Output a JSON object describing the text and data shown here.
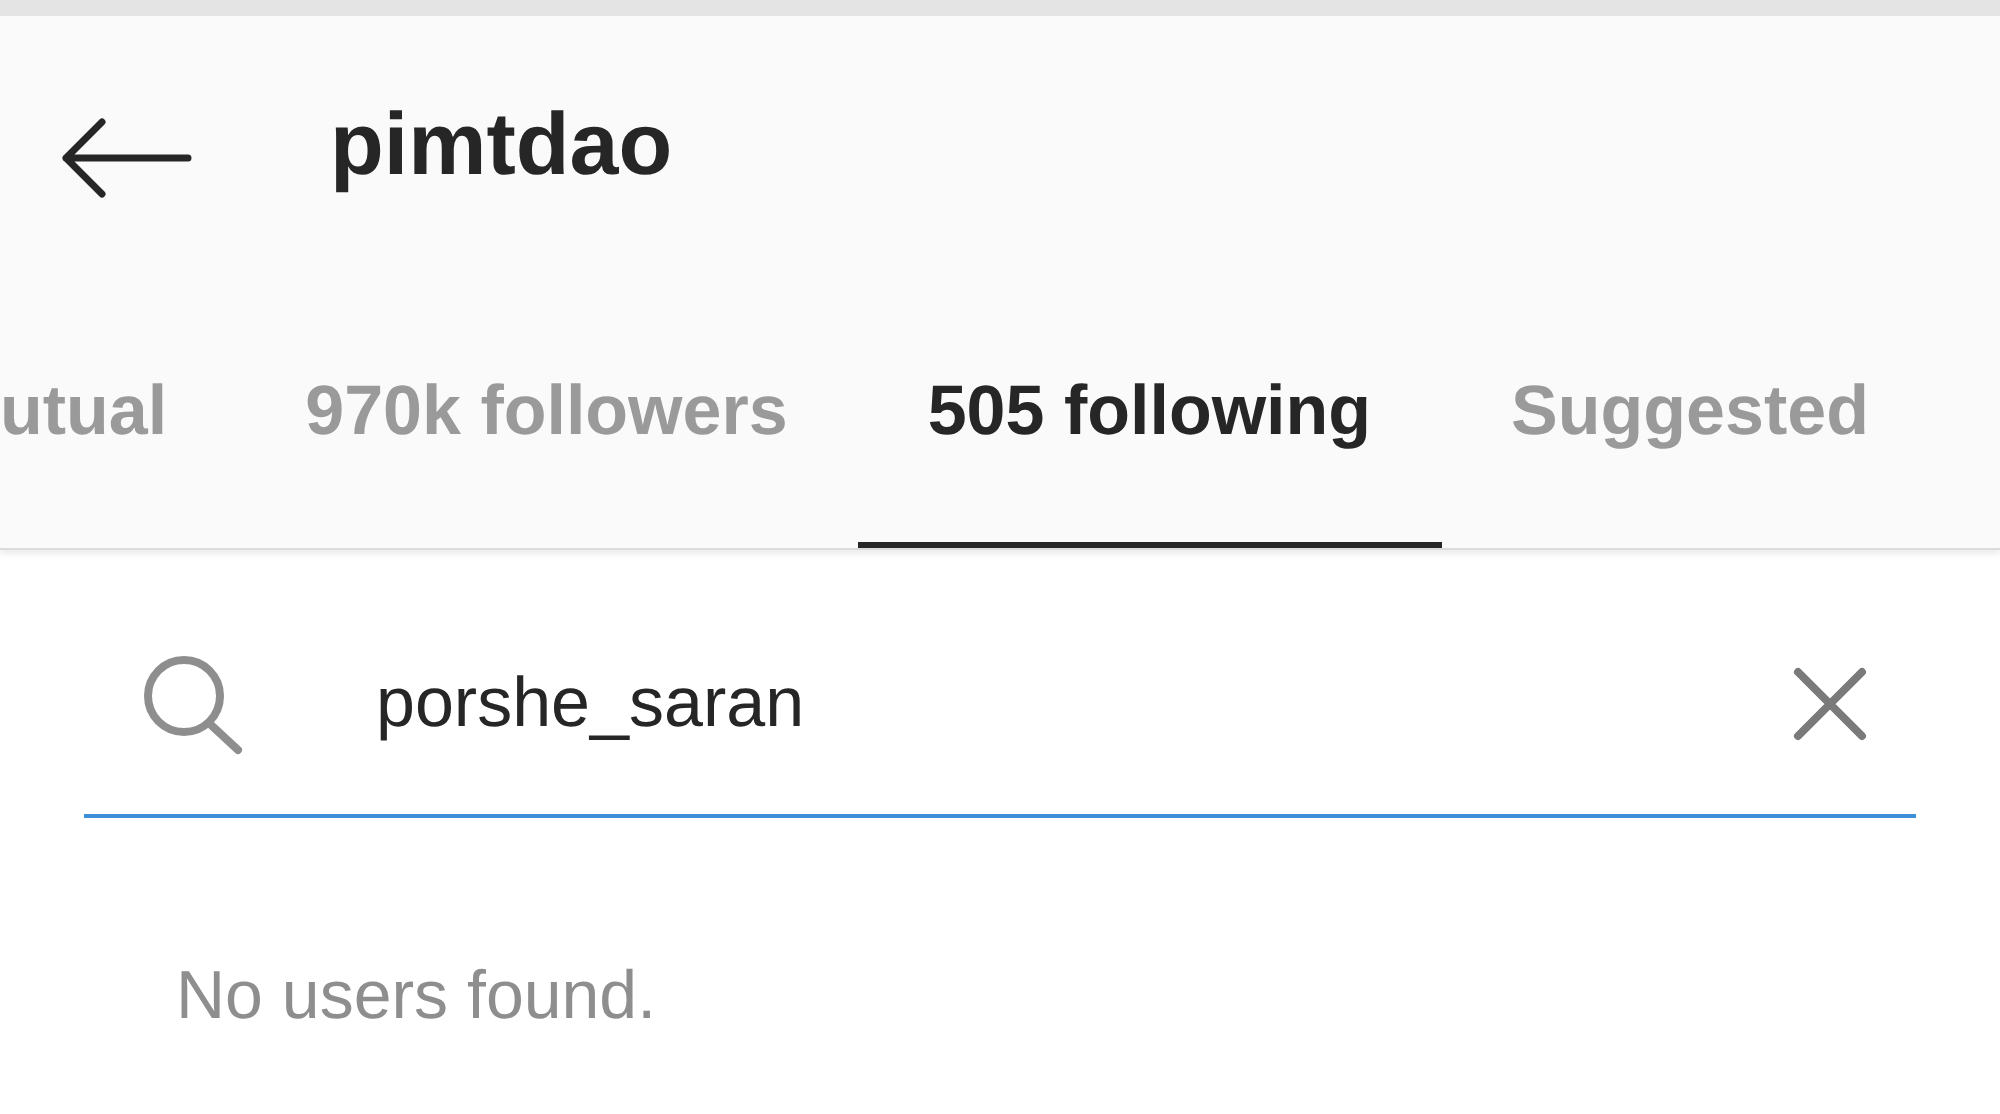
{
  "header": {
    "title": "pimtdao"
  },
  "tabs": [
    {
      "label": "utual",
      "selected": false
    },
    {
      "label": "970k followers",
      "selected": false
    },
    {
      "label": "505 following",
      "selected": true
    },
    {
      "label": "Suggested",
      "selected": false
    }
  ],
  "search": {
    "value": "porshe_saran"
  },
  "message": "No users found."
}
